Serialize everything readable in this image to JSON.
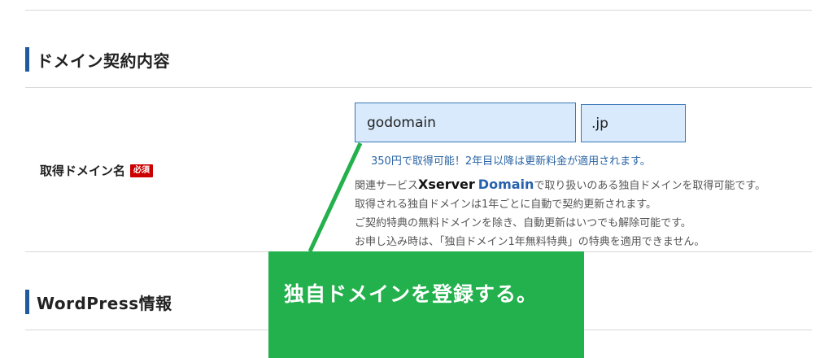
{
  "colors": {
    "accent": "#1d5b9e",
    "callout": "#22b14c",
    "required_badge": "#cc0000",
    "input_bg": "#d8eafc",
    "note_text": "#2a64a4"
  },
  "section_domain": {
    "title": "ドメイン契約内容"
  },
  "domain_field": {
    "label": "取得ドメイン名",
    "required_badge": "必須",
    "input_value": "godomain",
    "tld_value": ".jp",
    "price_note": "350円で取得可能！2年目以降は更新料金が適用されます。",
    "desc_prefix": "関連サービス",
    "brand_xserver": "Xserver",
    "brand_domain": "Domain",
    "desc_line1_suffix": "で取り扱いのある独自ドメインを取得可能です。",
    "desc_line2": "取得される独自ドメインは1年ごとに自動で契約更新されます。",
    "desc_line3": "ご契約特典の無料ドメインを除き、自動更新はいつでも解除可能です。",
    "desc_line4": "お申し込み時は、「独自ドメイン1年無料特典」の特典を適用できません。"
  },
  "section_wordpress": {
    "title": "WordPress情報"
  },
  "callout": {
    "text": "独自ドメインを登録する。"
  }
}
